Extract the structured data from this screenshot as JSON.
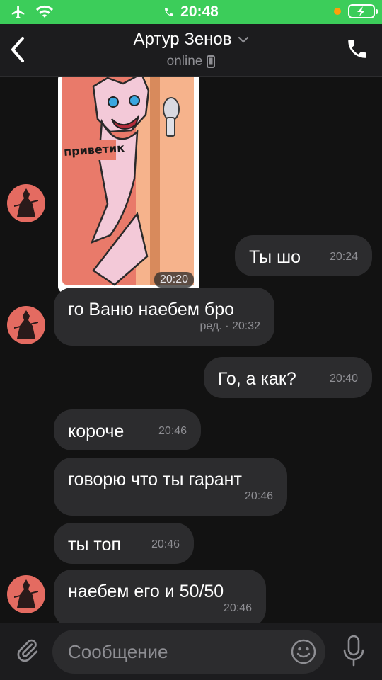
{
  "status_bar": {
    "time": "20:48"
  },
  "header": {
    "name": "Артур Зенов",
    "status": "online"
  },
  "sticker": {
    "caption": "приветик",
    "time": "20:20"
  },
  "messages": [
    {
      "text": "Ты шо",
      "time": "20:24",
      "direction": "out"
    },
    {
      "text": "го Ваню наебем бро",
      "time": "ред. · 20:32",
      "direction": "in"
    },
    {
      "text": "Го, а как?",
      "time": "20:40",
      "direction": "out"
    },
    {
      "text": "короче",
      "time": "20:46",
      "direction": "in"
    },
    {
      "text": "говорю что ты гарант",
      "time": "20:46",
      "direction": "in"
    },
    {
      "text": "ты топ",
      "time": "20:46",
      "direction": "in"
    },
    {
      "text": "наебем его и 50/50",
      "time": "20:46",
      "direction": "in"
    }
  ],
  "composer": {
    "placeholder": "Сообщение"
  },
  "colors": {
    "status_bar": "#3ccd5a",
    "bubble": "#2c2c2e",
    "background": "#121212",
    "avatar": "#e46b61"
  }
}
